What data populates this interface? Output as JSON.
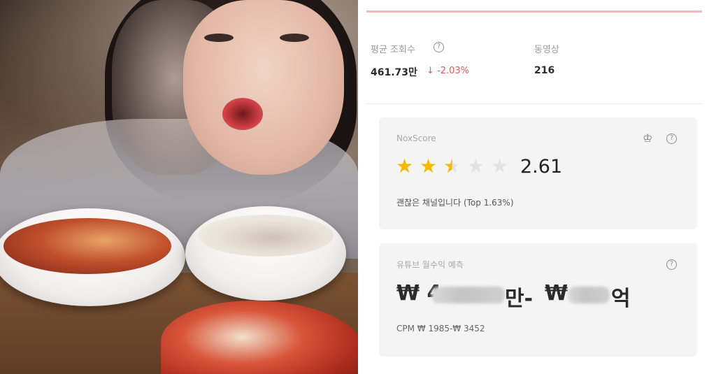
{
  "stats": {
    "avg_views_label": "평균 조회수",
    "avg_views_value": "461.73만",
    "avg_views_change": "↓ -2.03%",
    "videos_label": "동영상",
    "videos_value": "216",
    "help_glyph": "?"
  },
  "noxscore": {
    "title": "NoxScore",
    "rating": 2.5,
    "max_rating": 5,
    "score": "2.61",
    "description": "괜찮은 채널입니다 (Top 1.63%)",
    "crown_glyph": "♔",
    "help_glyph": "?"
  },
  "revenue": {
    "title": "유튜브 월수익 예측",
    "currency": "₩",
    "low_prefix": "₩ 4",
    "low_suffix": "만-",
    "high_prefix": "₩",
    "high_suffix": "억",
    "cpm_text": "CPM  ₩ 1985-₩ 3452",
    "help_glyph": "?"
  },
  "colors": {
    "star_filled": "#f5b800",
    "star_empty": "#e3e3e3",
    "accent_line": "#f0b9bd",
    "negative": "#e05a5a"
  }
}
